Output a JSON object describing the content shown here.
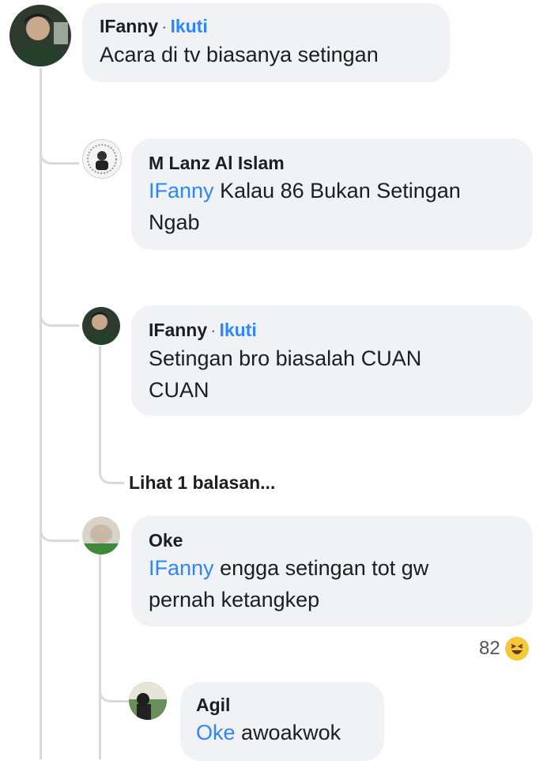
{
  "comments": [
    {
      "author": "IFanny",
      "follow": "Ikuti",
      "mention": "",
      "text": "Acara di tv biasanya setingan"
    },
    {
      "author": "M Lanz Al Islam",
      "follow": "",
      "mention": "IFanny",
      "text": "Kalau 86 Bukan Setingan Ngab"
    },
    {
      "author": "IFanny",
      "follow": "Ikuti",
      "mention": "",
      "text": "Setingan bro biasalah CUAN CUAN"
    },
    {
      "author": "Oke",
      "follow": "",
      "mention": "IFanny",
      "text": "engga setingan tot gw pernah ketangkep"
    },
    {
      "author": "Agil",
      "follow": "",
      "mention": "Oke",
      "text": "awoakwok"
    }
  ],
  "view_replies": "Lihat 1 balasan...",
  "reaction": {
    "count": "82",
    "icon": "haha-emoji-icon",
    "color": "#f7c83a"
  },
  "colors": {
    "bubble": "#f0f2f5",
    "link": "#2d86ff",
    "thread": "#d8dadf"
  }
}
